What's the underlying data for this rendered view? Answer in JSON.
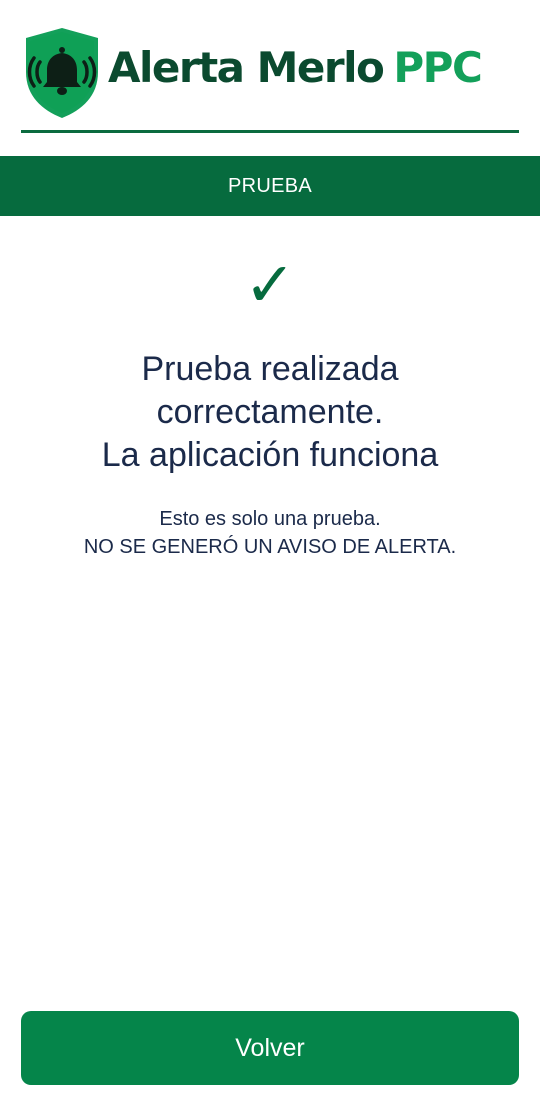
{
  "brand": {
    "name": "Alerta Merlo",
    "suffix": "PPC",
    "icon": "bell-shield-icon",
    "colors": {
      "dark": "#0b4a2f",
      "accent": "#13a05a",
      "divider": "#0b6b3f"
    }
  },
  "banner": {
    "title": "PRUEBA",
    "background": "#066b3e"
  },
  "status": {
    "icon": "checkmark-icon",
    "glyph": "✓",
    "color": "#066b3e"
  },
  "result": {
    "title_lines": [
      "Prueba realizada",
      "correctamente.",
      "La aplicación funciona"
    ],
    "note_lines": [
      "Esto es solo una prueba.",
      "NO SE GENERÓ UN AVISO DE ALERTA."
    ],
    "text_color": "#1b2a4a"
  },
  "actions": {
    "back_label": "Volver",
    "button_color": "#05854a"
  }
}
